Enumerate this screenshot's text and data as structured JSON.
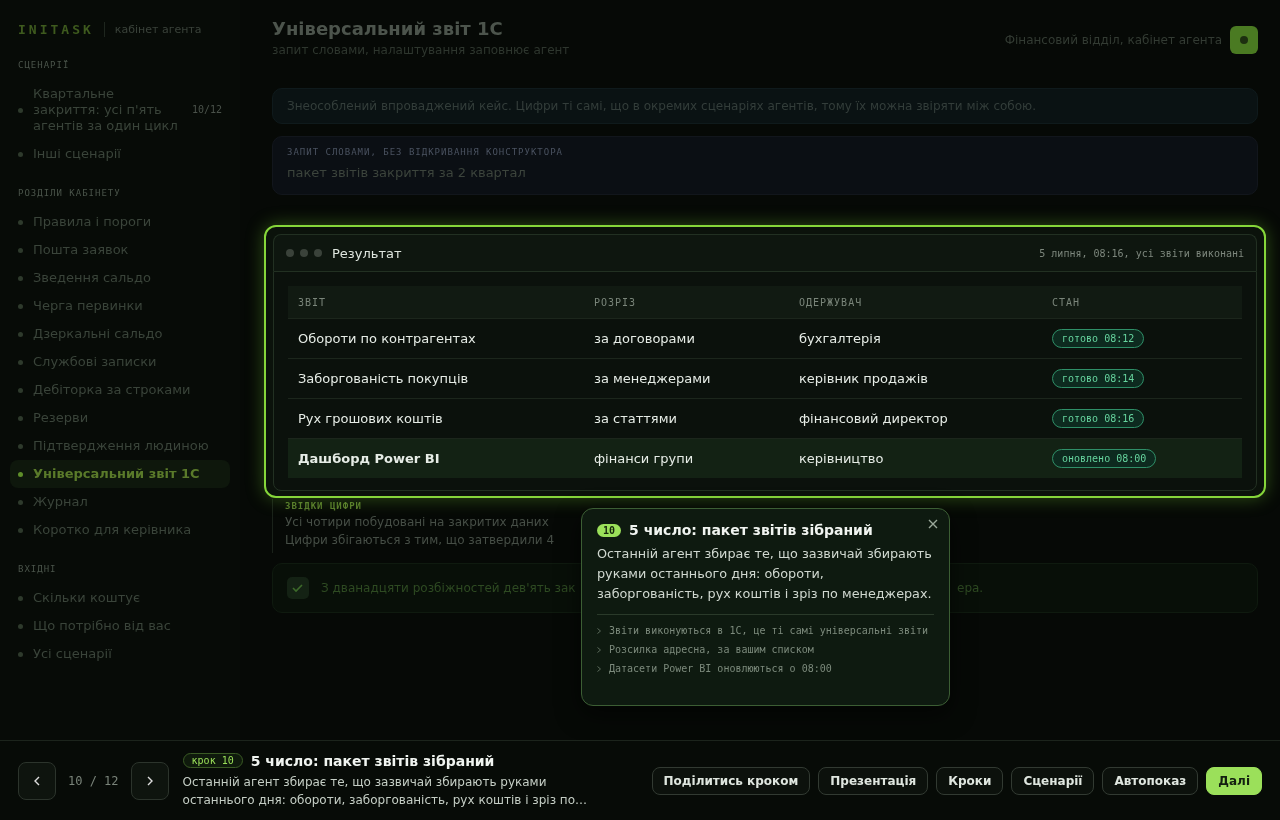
{
  "brand": {
    "logo": "INITASK",
    "subtitle": "кабінет агента"
  },
  "sidebar": {
    "sections": [
      {
        "title": "СЦЕНАРІЇ",
        "items": [
          {
            "label": "Квартальне закриття: усі п'ять агентів за один цикл",
            "count": "10/12",
            "selected": false
          },
          {
            "label": "Інші сценарії",
            "selected": false
          }
        ]
      },
      {
        "title": "РОЗДІЛИ КАБІНЕТУ",
        "items": [
          {
            "label": "Правила і пороги",
            "selected": false
          },
          {
            "label": "Пошта заявок",
            "selected": false
          },
          {
            "label": "Зведення сальдо",
            "selected": false
          },
          {
            "label": "Черга первинки",
            "selected": false
          },
          {
            "label": "Дзеркальні сальдо",
            "selected": false
          },
          {
            "label": "Службові записки",
            "selected": false
          },
          {
            "label": "Дебіторка за строками",
            "selected": false
          },
          {
            "label": "Резерви",
            "selected": false
          },
          {
            "label": "Підтвердження людиною",
            "selected": false
          },
          {
            "label": "Універсальний звіт 1С",
            "selected": true
          },
          {
            "label": "Журнал",
            "selected": false
          },
          {
            "label": "Коротко для керівника",
            "selected": false
          }
        ]
      },
      {
        "title": "ВХІДНІ",
        "items": [
          {
            "label": "Скільки коштує",
            "selected": false
          },
          {
            "label": "Що потрібно від вас",
            "selected": false
          },
          {
            "label": "Усі сценарії",
            "selected": false
          }
        ]
      }
    ]
  },
  "header": {
    "title": "Універсальний звіт 1С",
    "subtitle": "запит словами, налаштування заповнює агент",
    "account": "Фінансовий відділ, кабінет агента"
  },
  "info": "Знеособлений впроваджений кейс. Цифри ті самі, що в окремих сценаріях агентів, тому їх можна звіряти між собою.",
  "query": {
    "label": "ЗАПИТ СЛОВАМИ, БЕЗ ВІДКРИВАННЯ КОНСТРУКТОРА",
    "text": "пакет звітів закриття за 2 квартал"
  },
  "result": {
    "title": "Результат",
    "meta": "5 липня, 08:16, усі звіти виконані",
    "columns": [
      "ЗВІТ",
      "РОЗРІЗ",
      "ОДЕРЖУВАЧ",
      "СТАН"
    ],
    "rows": [
      {
        "report": "Обороти по контрагентах",
        "slice": "за договорами",
        "recipient": "бухгалтерія",
        "status": "готово 08:12",
        "selected": false
      },
      {
        "report": "Заборгованість покупців",
        "slice": "за менеджерами",
        "recipient": "керівник продажів",
        "status": "готово 08:14",
        "selected": false
      },
      {
        "report": "Рух грошових коштів",
        "slice": "за статтями",
        "recipient": "фінансовий директор",
        "status": "готово 08:16",
        "selected": false
      },
      {
        "report": "Дашборд Power BI",
        "slice": "фінанси групи",
        "recipient": "керівництво",
        "status": "оновлено 08:00",
        "selected": true
      }
    ]
  },
  "source": {
    "title": "ЗВІДКИ ЦИФРИ",
    "lines": [
      "Усі чотири побудовані на закритих даних",
      "Цифри збігаються з тим, що затвердили 4"
    ]
  },
  "note": {
    "text": "З дванадцяти розбіжностей дев'ять зак",
    "tail": "ера."
  },
  "tooltip": {
    "step": "10",
    "title": "5 число: пакет звітів зібраний",
    "text": "Останній агент збирає те, що зазвичай збирають руками останнього дня: обороти, заборгованість, рух коштів і зріз по менеджерах.",
    "points": [
      "Звіти виконуються в 1С, це ті самі універсальні звіти",
      "Розсилка адресна, за вашим списком",
      "Датасети Power BI оновлюються о 08:00"
    ]
  },
  "footer": {
    "counter": "10 / 12",
    "step": "крок 10",
    "title": "5 число: пакет звітів зібраний",
    "text": "Останній агент збирає те, що зазвичай збирають руками останнього дня: обороти, заборгованість, рух коштів і зріз по…",
    "buttons": [
      {
        "label": "Поділитись кроком",
        "kind": "secondary"
      },
      {
        "label": "Презентація",
        "kind": "secondary"
      },
      {
        "label": "Кроки",
        "kind": "secondary"
      },
      {
        "label": "Сценарії",
        "kind": "secondary"
      },
      {
        "label": "Автопоказ",
        "kind": "secondary"
      },
      {
        "label": "Далі",
        "kind": "primary"
      }
    ]
  }
}
